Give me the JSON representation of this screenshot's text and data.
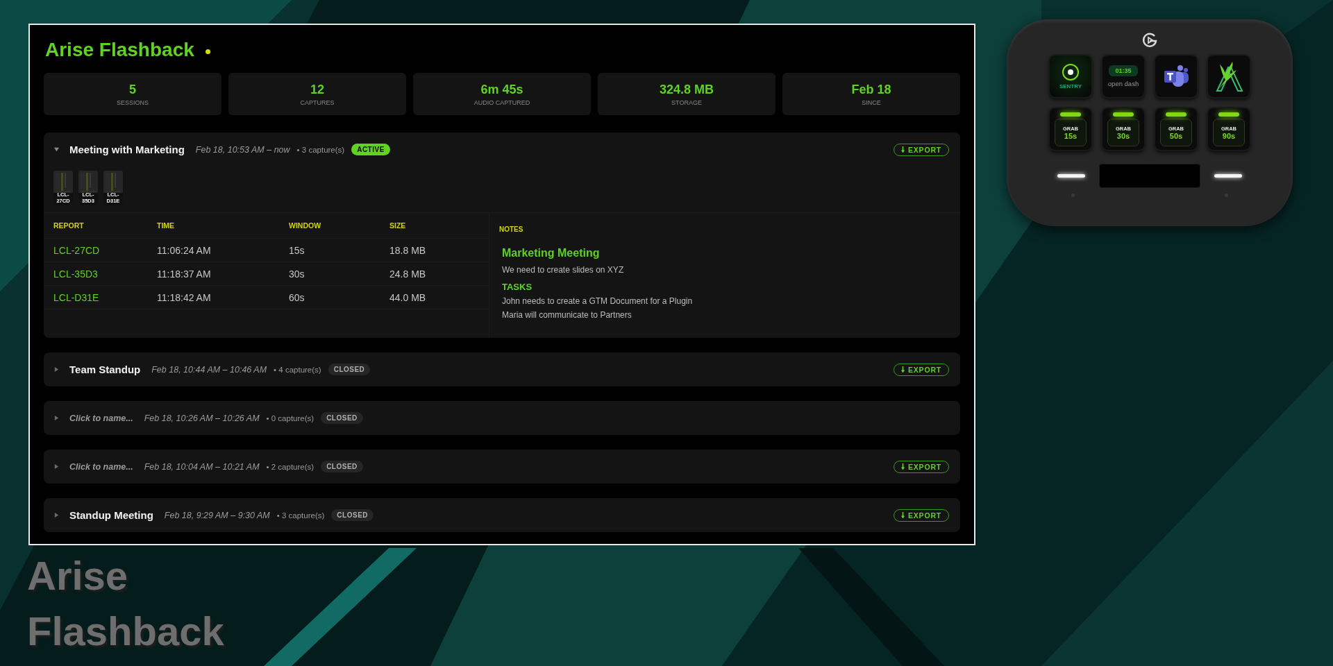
{
  "app": {
    "title": "Arise Flashback",
    "live": true
  },
  "stats": [
    {
      "value": "5",
      "label": "SESSIONS"
    },
    {
      "value": "12",
      "label": "CAPTURES"
    },
    {
      "value": "6m 45s",
      "label": "AUDIO CAPTURED"
    },
    {
      "value": "324.8 MB",
      "label": "STORAGE"
    },
    {
      "value": "Feb 18",
      "label": "SINCE"
    }
  ],
  "sessions": [
    {
      "name": "Meeting with Marketing",
      "named": true,
      "time": "Feb 18, 10:53 AM – now",
      "captures": "• 3 capture(s)",
      "status": "ACTIVE",
      "active": true,
      "expanded": true,
      "export": "EXPORT",
      "thumbnails": [
        {
          "label": "LCL-27CD"
        },
        {
          "label": "LCL-35D3"
        },
        {
          "label": "LCL-D31E"
        }
      ],
      "table": {
        "columns": [
          "REPORT",
          "TIME",
          "WINDOW",
          "SIZE"
        ],
        "rows": [
          [
            "LCL-27CD",
            "11:06:24 AM",
            "15s",
            "18.8 MB"
          ],
          [
            "LCL-35D3",
            "11:18:37 AM",
            "30s",
            "24.8 MB"
          ],
          [
            "LCL-D31E",
            "11:18:42 AM",
            "60s",
            "44.0 MB"
          ]
        ]
      },
      "notes": {
        "label": "NOTES",
        "heading": "Marketing Meeting",
        "text": "We need to create slides on XYZ",
        "tasks_heading": "TASKS",
        "tasks": [
          "John needs to create a GTM Document for a Plugin",
          "Maria will communicate to Partners"
        ]
      }
    },
    {
      "name": "Team Standup",
      "named": true,
      "time": "Feb 18, 10:44 AM – 10:46 AM",
      "captures": "• 4 capture(s)",
      "status": "CLOSED",
      "active": false,
      "expanded": false,
      "export": "EXPORT"
    },
    {
      "name": "Click to name...",
      "named": false,
      "time": "Feb 18, 10:26 AM – 10:26 AM",
      "captures": "• 0 capture(s)",
      "status": "CLOSED",
      "active": false,
      "expanded": false
    },
    {
      "name": "Click to name...",
      "named": false,
      "time": "Feb 18, 10:04 AM – 10:21 AM",
      "captures": "• 2 capture(s)",
      "status": "CLOSED",
      "active": false,
      "expanded": false,
      "export": "EXPORT"
    },
    {
      "name": "Standup Meeting",
      "named": true,
      "time": "Feb 18, 9:29 AM – 9:30 AM",
      "captures": "• 3 capture(s)",
      "status": "CLOSED",
      "active": false,
      "expanded": false,
      "export": "EXPORT"
    }
  ],
  "device": {
    "keys": [
      {
        "kind": "sentry",
        "label": "SENTRY"
      },
      {
        "kind": "timer",
        "time": "01:35",
        "label": "open dash"
      },
      {
        "kind": "chat-app"
      },
      {
        "kind": "bird-logo"
      },
      {
        "kind": "grab",
        "label": "GRAB",
        "value": "15s"
      },
      {
        "kind": "grab",
        "label": "GRAB",
        "value": "30s"
      },
      {
        "kind": "grab",
        "label": "GRAB",
        "value": "50s"
      },
      {
        "kind": "grab",
        "label": "GRAB",
        "value": "90s"
      }
    ]
  },
  "caption": {
    "lines": [
      "Arise",
      "Flashback"
    ]
  }
}
